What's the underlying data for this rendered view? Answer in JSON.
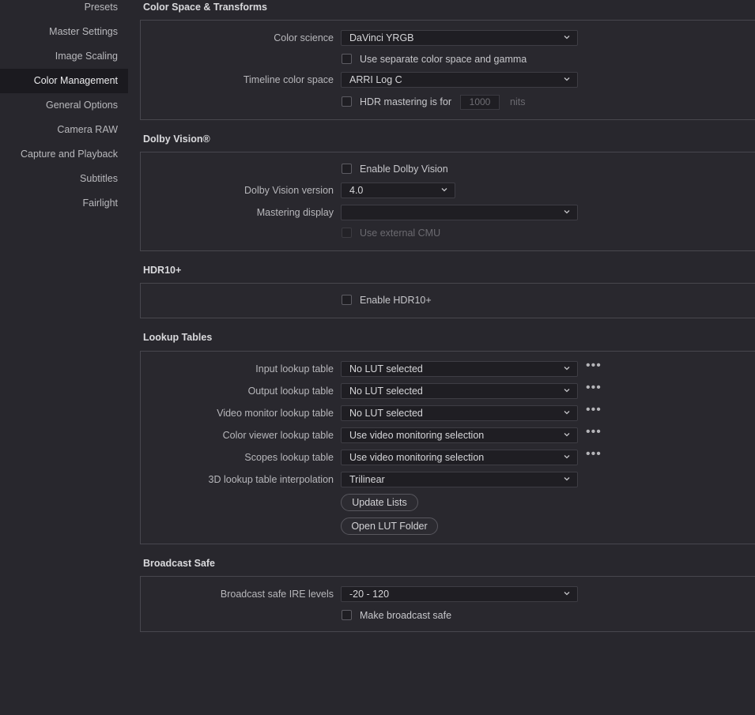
{
  "sidebar": {
    "items": [
      {
        "label": "Presets"
      },
      {
        "label": "Master Settings"
      },
      {
        "label": "Image Scaling"
      },
      {
        "label": "Color Management"
      },
      {
        "label": "General Options"
      },
      {
        "label": "Camera RAW"
      },
      {
        "label": "Capture and Playback"
      },
      {
        "label": "Subtitles"
      },
      {
        "label": "Fairlight"
      }
    ],
    "active": "Color Management"
  },
  "color_space": {
    "title": "Color Space & Transforms",
    "color_science_label": "Color science",
    "color_science_value": "DaVinci YRGB",
    "separate_label": "Use separate color space and gamma",
    "timeline_label": "Timeline color space",
    "timeline_value": "ARRI Log C",
    "hdr_label": "HDR mastering is for",
    "hdr_value": "1000",
    "hdr_unit": "nits"
  },
  "dolby": {
    "title": "Dolby Vision®",
    "enable_label": "Enable Dolby Vision",
    "version_label": "Dolby Vision version",
    "version_value": "4.0",
    "mastering_label": "Mastering display",
    "mastering_value": "",
    "cmu_label": "Use external CMU"
  },
  "hdr10": {
    "title": "HDR10+",
    "enable_label": "Enable HDR10+"
  },
  "lut": {
    "title": "Lookup Tables",
    "input_label": "Input lookup table",
    "input_value": "No LUT selected",
    "output_label": "Output lookup table",
    "output_value": "No LUT selected",
    "video_label": "Video monitor lookup table",
    "video_value": "No LUT selected",
    "viewer_label": "Color viewer lookup table",
    "viewer_value": "Use video monitoring selection",
    "scopes_label": "Scopes lookup table",
    "scopes_value": "Use video monitoring selection",
    "interp_label": "3D lookup table interpolation",
    "interp_value": "Trilinear",
    "update_button": "Update Lists",
    "open_button": "Open LUT Folder"
  },
  "broadcast": {
    "title": "Broadcast Safe",
    "ire_label": "Broadcast safe IRE levels",
    "ire_value": "-20 - 120",
    "make_safe_label": "Make broadcast safe"
  },
  "icons": {
    "dropdown": "chevron-down-icon",
    "more": "more-dots-icon"
  },
  "colors": {
    "background": "#28272d",
    "active_item": "#1b1a1f",
    "field": "#1f1e23",
    "border": "#48474e"
  }
}
